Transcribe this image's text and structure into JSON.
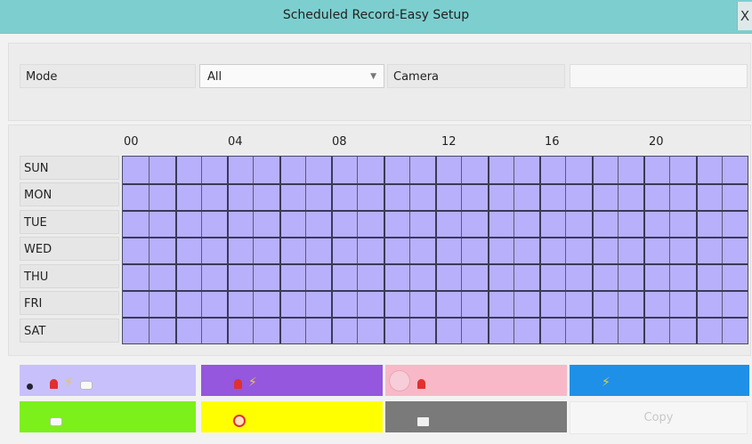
{
  "window": {
    "title": "Scheduled Record-Easy Setup",
    "close_label": "X"
  },
  "mode": {
    "label": "Mode",
    "value": "All",
    "camera_label": "Camera",
    "camera_value": ""
  },
  "schedule": {
    "hours": [
      "00",
      "04",
      "08",
      "12",
      "16",
      "20"
    ],
    "days": [
      "SUN",
      "MON",
      "TUE",
      "WED",
      "THU",
      "FRI",
      "SAT"
    ],
    "fill_color": "#b8b0fb"
  },
  "legend": [
    {
      "color": "#c8c0fa",
      "icons": [
        "dot-icon",
        "alarm-bell-icon",
        "lightning-icon",
        "motion-icon"
      ],
      "selected": true
    },
    {
      "color": "#9457dd",
      "icons": [
        "alarm-bell-icon",
        "lightning-icon"
      ]
    },
    {
      "color": "#f8b8c8",
      "icons": [
        "alarm-bell-icon"
      ]
    },
    {
      "color": "#1e90e8",
      "icons": [
        "lightning-icon"
      ]
    },
    {
      "color": "#7cf01a",
      "icons": [
        "motion-icon"
      ]
    },
    {
      "color": "#ffff00",
      "icons": [
        "no-record-icon"
      ]
    },
    {
      "color": "#7a7a7a",
      "icons": [
        "folder-icon"
      ]
    }
  ],
  "copy_label": "Copy"
}
